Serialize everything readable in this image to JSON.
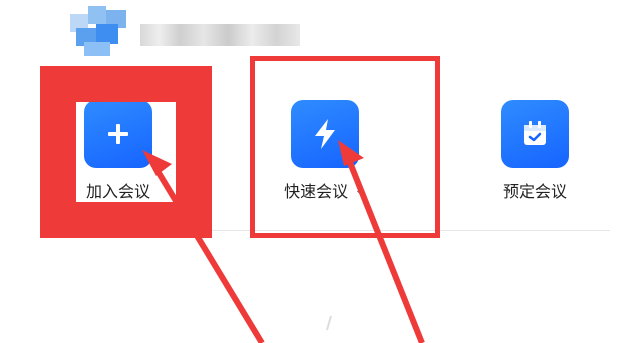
{
  "header": {
    "avatar_name": "avatar",
    "username_name": "username"
  },
  "actions": [
    {
      "label": "加入会议",
      "icon": "plus-icon"
    },
    {
      "label": "快速会议",
      "icon": "lightning-icon",
      "has_dropdown": true
    },
    {
      "label": "预定会议",
      "icon": "calendar-icon"
    }
  ],
  "annotation": {
    "color": "#ef3a3a"
  },
  "colors": {
    "tile_start": "#2f8cff",
    "tile_end": "#1664ff"
  }
}
